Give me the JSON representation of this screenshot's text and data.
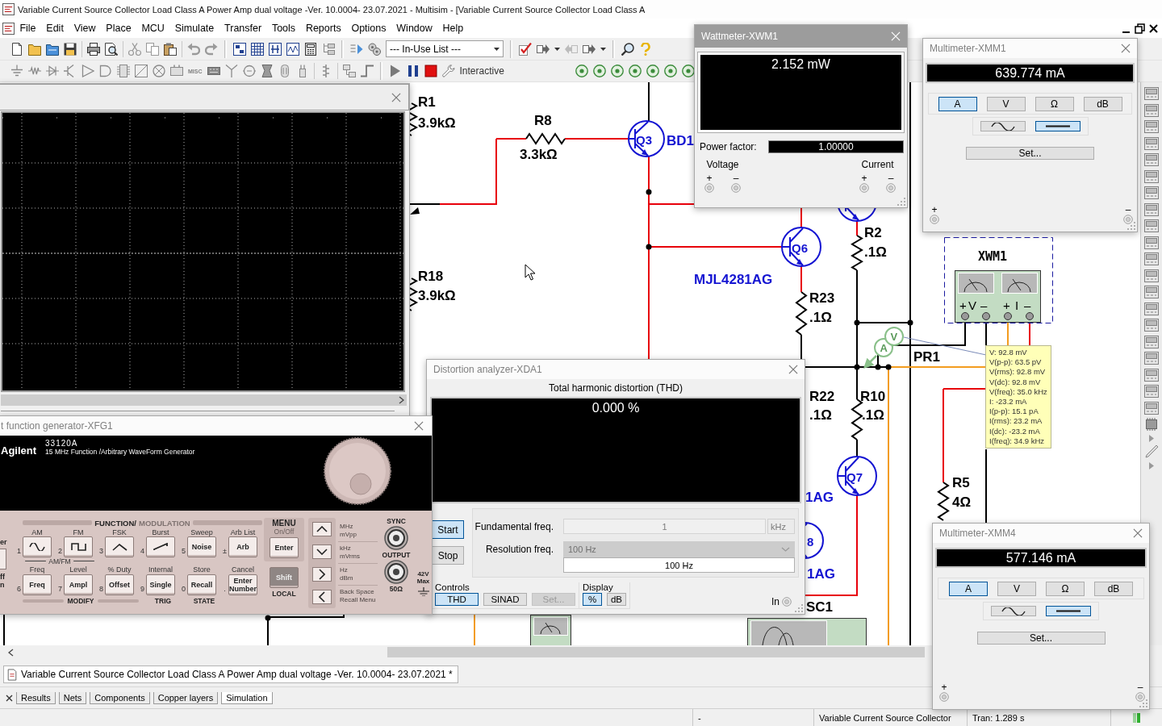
{
  "window": {
    "title": "Variable Current Source Collector Load Class A Power Amp dual voltage -Ver. 10.0004- 23.07.2021 - Multisim - [Variable Current Source Collector Load Class A"
  },
  "menu": [
    "File",
    "Edit",
    "View",
    "Place",
    "MCU",
    "Simulate",
    "Transfer",
    "Tools",
    "Reports",
    "Options",
    "Window",
    "Help"
  ],
  "toolbar": {
    "in_use_list": "--- In-Use List ---",
    "misc_label": "MISC",
    "simulation_mode": "Interactive"
  },
  "schematic": {
    "components": [
      {
        "kind": "resistor",
        "ref": "R1",
        "value": "3.9kΩ"
      },
      {
        "kind": "resistor",
        "ref": "R8",
        "value": "3.3kΩ"
      },
      {
        "kind": "transistor",
        "ref": "Q3",
        "part": "BD1"
      },
      {
        "kind": "transistor",
        "ref": "Q6",
        "part": "MJL4281AG"
      },
      {
        "kind": "resistor",
        "ref": "R18",
        "value": "3.9kΩ"
      },
      {
        "kind": "resistor",
        "ref": "R23",
        "value": ".1Ω"
      },
      {
        "kind": "resistor",
        "ref": "R2",
        "value": ".1Ω"
      },
      {
        "kind": "resistor",
        "ref": "R22",
        "value": ".1Ω"
      },
      {
        "kind": "resistor",
        "ref": "R10",
        "value": ".1Ω"
      },
      {
        "kind": "transistor",
        "ref": "Q7",
        "part": "1AG"
      },
      {
        "kind": "transistor",
        "ref": "8",
        "part": "1AG"
      },
      {
        "kind": "resistor",
        "ref": "R5",
        "value": "4Ω"
      }
    ],
    "wattmeter_symbol": {
      "ref": "XWM1",
      "terminal_labels": [
        "+",
        "V",
        "–",
        "+",
        "I",
        "–"
      ]
    },
    "probe": {
      "ref": "PR1",
      "letters": [
        "A",
        "V"
      ],
      "readings": [
        "V: 92.8 mV",
        "V(p-p): 63.5 pV",
        "V(rms): 92.8 mV",
        "V(dc): 92.8 mV",
        "V(freq): 35.0 kHz",
        "I: -23.2 mA",
        "I(p-p): 15.1 pA",
        "I(rms): 23.2 mA",
        "I(dc): -23.2 mA",
        "I(freq): 34.9 kHz"
      ]
    },
    "scope_symbol": {
      "ref": "SC1"
    }
  },
  "function_generator": {
    "title": "t function generator-XFG1",
    "brand": "Agilent",
    "model": "33120A",
    "description": "15 MHz Function /Arbitrary WaveForm Generator",
    "section_title": [
      "FUNCTION/",
      "MODULATION"
    ],
    "top_keys": [
      {
        "label": "AM",
        "number": "1",
        "kind": "sine"
      },
      {
        "label": "FM",
        "number": "2",
        "kind": "square"
      },
      {
        "label": "FSK",
        "number": "3",
        "kind": "triangle"
      },
      {
        "label": "Burst",
        "number": "4",
        "kind": "ramp"
      },
      {
        "label": "Sweep",
        "number": "5",
        "kind": "text",
        "text": "Noise"
      },
      {
        "label": "Arb List",
        "number": "±",
        "kind": "text",
        "text": "Arb"
      }
    ],
    "bracket_label": "AM/FM",
    "bottom_keys": [
      {
        "label": "Freq",
        "number": "6",
        "text": "Freq"
      },
      {
        "label": "Level",
        "number": "7",
        "text": "Ampl"
      },
      {
        "label": "% Duty",
        "number": "8",
        "text": "Offset"
      },
      {
        "label": "Internal",
        "number": "9",
        "text": "Single"
      },
      {
        "label": "Store",
        "number": "0",
        "text": "Recall"
      },
      {
        "label": "Cancel",
        "number": ".",
        "text": "Enter Number"
      }
    ],
    "groups": [
      "MODIFY",
      "TRIG",
      "STATE"
    ],
    "menu_label": "MENU",
    "menu_sublabel": "On/Off",
    "enter_key": "Enter",
    "shift_key": "Shift",
    "local_label": "LOCAL",
    "unit_labels": [
      [
        "MHz",
        "mVpp"
      ],
      [
        "kHz",
        "mVrms"
      ],
      [
        "Hz",
        "dBm"
      ],
      [
        "Back Space",
        "Recall Menu"
      ]
    ],
    "sync_label": "SYNC",
    "output_label": "OUTPUT",
    "impedance": "50Ω",
    "max_voltage": "42V Max",
    "edge_fragments": [
      "er",
      "ff",
      "n"
    ]
  },
  "distortion_analyzer": {
    "title": "Distortion analyzer-XDA1",
    "heading": "Total harmonic distortion (THD)",
    "reading": "0.000 %",
    "run_buttons": [
      {
        "label": "Start",
        "selected": true
      },
      {
        "label": "Stop",
        "selected": false
      }
    ],
    "fundamental": {
      "label": "Fundamental freq.",
      "value": "1",
      "unit": "kHz",
      "disabled": true
    },
    "resolution": {
      "label": "Resolution freq.",
      "value": "100 Hz",
      "disabled": true,
      "display": "100 Hz"
    },
    "controls": {
      "label": "Controls",
      "buttons": [
        {
          "label": "THD",
          "selected": true,
          "disabled": false
        },
        {
          "label": "SINAD",
          "selected": false,
          "disabled": false
        },
        {
          "label": "Set...",
          "selected": false,
          "disabled": true
        }
      ]
    },
    "display": {
      "label": "Display",
      "buttons": [
        {
          "label": "%",
          "selected": true
        },
        {
          "label": "dB",
          "selected": false
        }
      ]
    },
    "terminal": "In"
  },
  "wattmeter": {
    "title": "Wattmeter-XWM1",
    "reading": "2.152 mW",
    "power_factor": {
      "label": "Power factor:",
      "value": "1.00000"
    },
    "groups": [
      {
        "label": "Voltage",
        "terminals": [
          "+",
          "–"
        ]
      },
      {
        "label": "Current",
        "terminals": [
          "+",
          "–"
        ]
      }
    ]
  },
  "multimeters": [
    {
      "title": "Multimeter-XMM1",
      "reading": "639.774 mA",
      "modes": [
        {
          "label": "A",
          "selected": true
        },
        {
          "label": "V",
          "selected": false
        },
        {
          "label": "Ω",
          "selected": false
        },
        {
          "label": "dB",
          "selected": false
        }
      ],
      "signal": [
        {
          "kind": "ac",
          "selected": false
        },
        {
          "kind": "dc",
          "selected": true
        }
      ],
      "set_button": "Set...",
      "terminals": [
        "+",
        "–"
      ]
    },
    {
      "title": "Multimeter-XMM4",
      "reading": "577.146 mA",
      "modes": [
        {
          "label": "A",
          "selected": true
        },
        {
          "label": "V",
          "selected": false
        },
        {
          "label": "Ω",
          "selected": false
        },
        {
          "label": "dB",
          "selected": false
        }
      ],
      "signal": [
        {
          "kind": "ac",
          "selected": false
        },
        {
          "kind": "dc",
          "selected": true
        }
      ],
      "set_button": "Set...",
      "terminals": [
        "+",
        "–"
      ]
    }
  ],
  "document_tabs": [
    {
      "label": "Variable Current Source Collector Load Class A Power Amp dual voltage -Ver. 10.0004- 23.07.2021 *",
      "selected": true
    }
  ],
  "spreadsheet_tabs": [
    {
      "label": "Results",
      "selected": false
    },
    {
      "label": "Nets",
      "selected": false
    },
    {
      "label": "Components",
      "selected": false
    },
    {
      "label": "Copper layers",
      "selected": false
    },
    {
      "label": "Simulation",
      "selected": true
    }
  ],
  "status_bar": [
    "-",
    "Variable Current Source Collector",
    "Tran: 1.289 s"
  ]
}
